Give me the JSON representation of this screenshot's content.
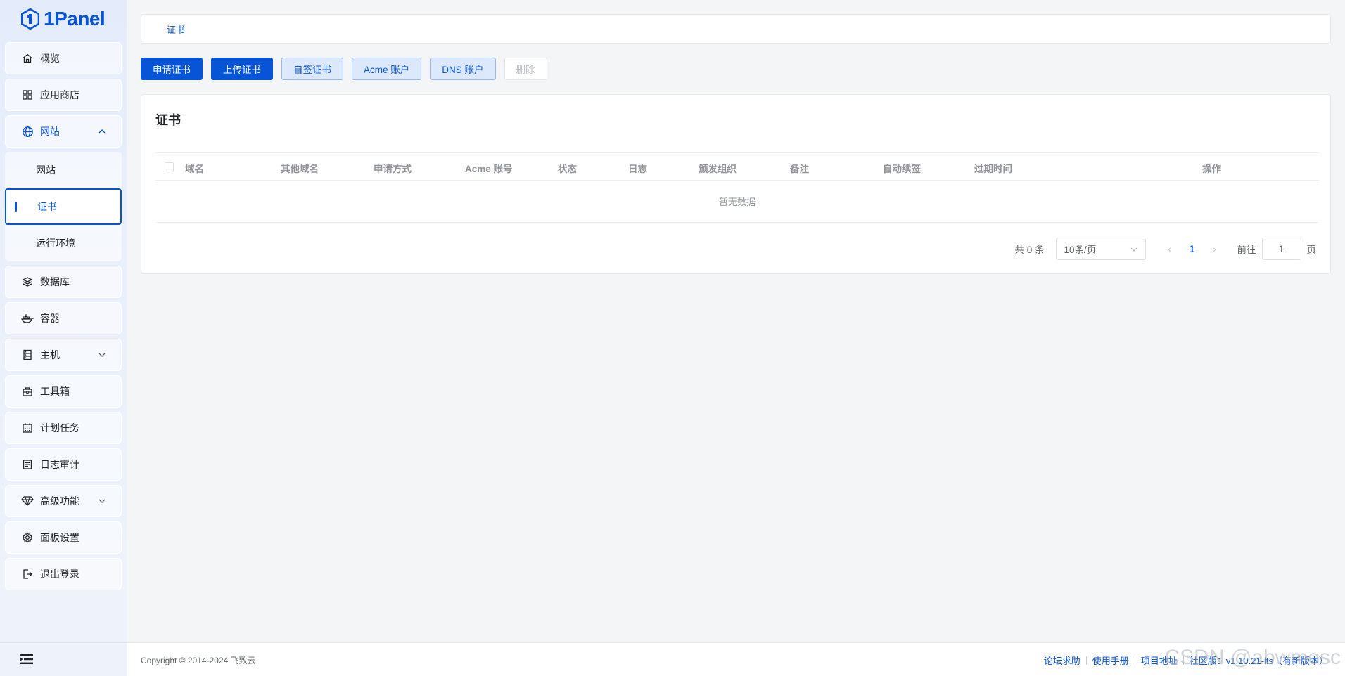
{
  "app": {
    "logo_text": "1Panel"
  },
  "sidebar": {
    "items": [
      {
        "label": "概览",
        "icon": "home-icon"
      },
      {
        "label": "应用商店",
        "icon": "grid-icon"
      },
      {
        "label": "网站",
        "icon": "globe-icon",
        "expanded": true,
        "children": [
          {
            "label": "网站"
          },
          {
            "label": "证书",
            "active": true
          },
          {
            "label": "运行环境"
          }
        ]
      },
      {
        "label": "数据库",
        "icon": "layers-icon"
      },
      {
        "label": "容器",
        "icon": "docker-icon"
      },
      {
        "label": "主机",
        "icon": "server-icon",
        "expandable": true
      },
      {
        "label": "工具箱",
        "icon": "toolbox-icon"
      },
      {
        "label": "计划任务",
        "icon": "calendar-icon"
      },
      {
        "label": "日志审计",
        "icon": "log-icon"
      },
      {
        "label": "高级功能",
        "icon": "diamond-icon",
        "expandable": true
      },
      {
        "label": "面板设置",
        "icon": "gear-icon"
      },
      {
        "label": "退出登录",
        "icon": "logout-icon"
      }
    ]
  },
  "breadcrumb": {
    "current": "证书"
  },
  "toolbar": {
    "apply_label": "申请证书",
    "upload_label": "上传证书",
    "selfsign_label": "自签证书",
    "acme_label": "Acme 账户",
    "dns_label": "DNS 账户",
    "delete_label": "删除"
  },
  "card": {
    "title": "证书"
  },
  "table": {
    "columns": [
      "域名",
      "其他域名",
      "申请方式",
      "Acme 账号",
      "状态",
      "日志",
      "颁发组织",
      "备注",
      "自动续签",
      "过期时间",
      "操作"
    ],
    "empty_text": "暂无数据"
  },
  "pagination": {
    "total": "共 0 条",
    "page_size": "10条/页",
    "current_page": "1",
    "goto_label": "前往",
    "goto_value": "1",
    "page_suffix": "页"
  },
  "footer": {
    "copyright": "Copyright © 2014-2024 飞致云",
    "links": [
      "论坛求助",
      "使用手册",
      "项目地址",
      "社区版：v1.10.21-lts（有新版本）"
    ],
    "watermark": "CSDN @abwmosc"
  },
  "colors": {
    "accent": "#0854d6",
    "accent_light": "#dce8fb"
  }
}
